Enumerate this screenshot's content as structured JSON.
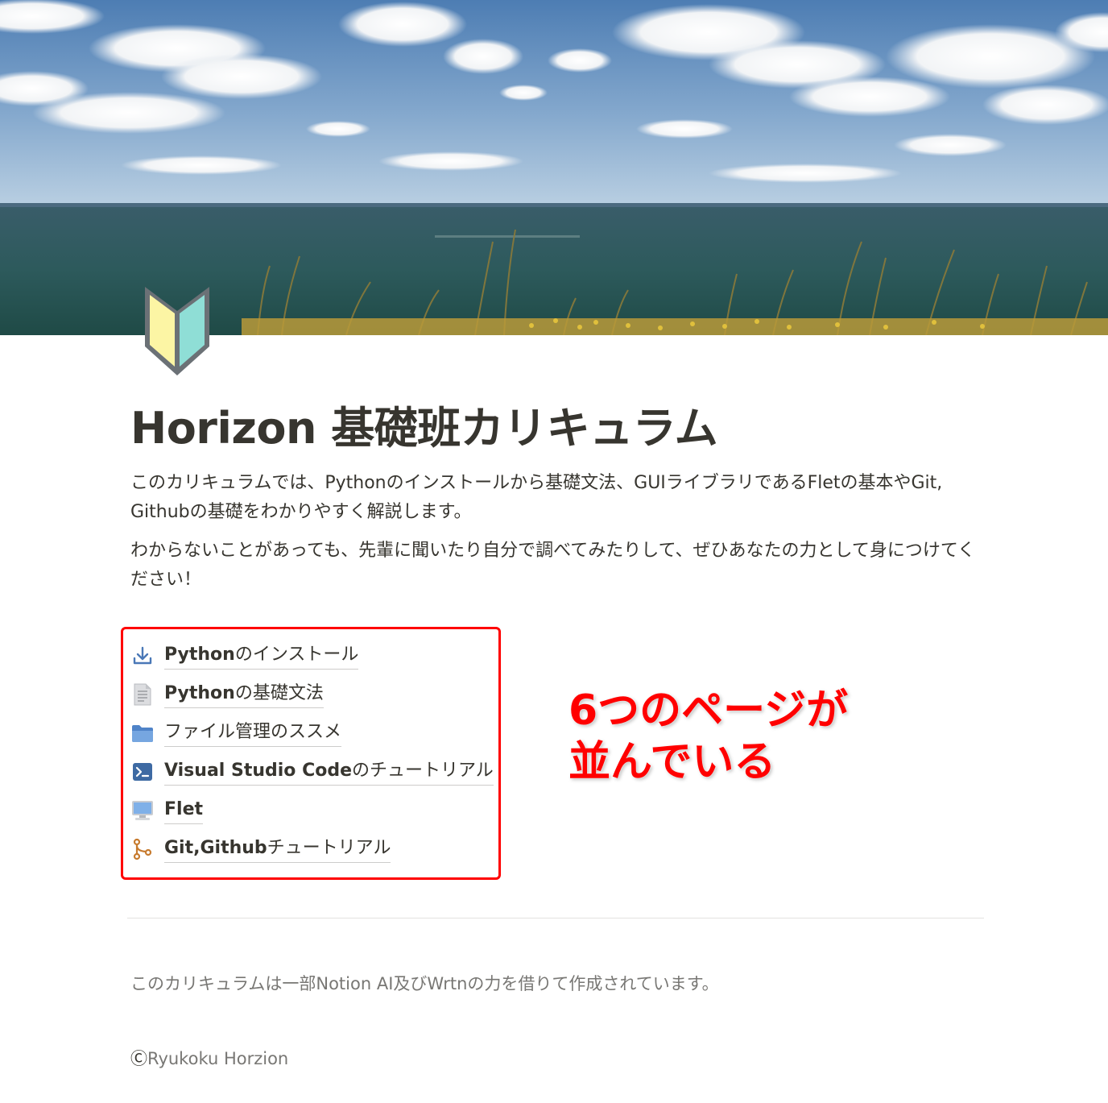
{
  "cover": {
    "description_icon": "seaside-landscape"
  },
  "page_icon": "beginner-mark-icon",
  "title": "Horizon 基礎班カリキュラム",
  "description": {
    "line1": "このカリキュラムでは、Pythonのインストールから基礎文法、GUIライブラリであるFletの基本やGit, Githubの基礎をわかりやすく解説します。",
    "line2": "わからないことがあっても、先輩に聞いたり自分で調べてみたりして、ぜひあなたの力として身につけてください！"
  },
  "links": [
    {
      "icon": "download-icon",
      "bold": "Python",
      "rest": "のインストール"
    },
    {
      "icon": "document-icon",
      "bold": "Python",
      "rest": "の基礎文法"
    },
    {
      "icon": "folder-icon",
      "bold": "",
      "rest": "ファイル管理のススメ"
    },
    {
      "icon": "terminal-icon",
      "bold": "Visual Studio Code",
      "rest": "のチュートリアル"
    },
    {
      "icon": "monitor-icon",
      "bold": "Flet",
      "rest": ""
    },
    {
      "icon": "git-branch-icon",
      "bold": "Git,Github",
      "rest": "チュートリアル"
    }
  ],
  "annotation": "6つのページが\n並んでいる",
  "footer": {
    "note": "このカリキュラムは一部Notion AI及びWrtnの力を借りて作成されています。",
    "copyright_mark": "Ⓒ",
    "copyright_text": "Ryukoku Horzion"
  },
  "colors": {
    "text": "#37352f",
    "muted": "#787774",
    "annotation": "#ff0000",
    "icon_blue": "#4a78b7",
    "icon_orange": "#c77b2f"
  }
}
